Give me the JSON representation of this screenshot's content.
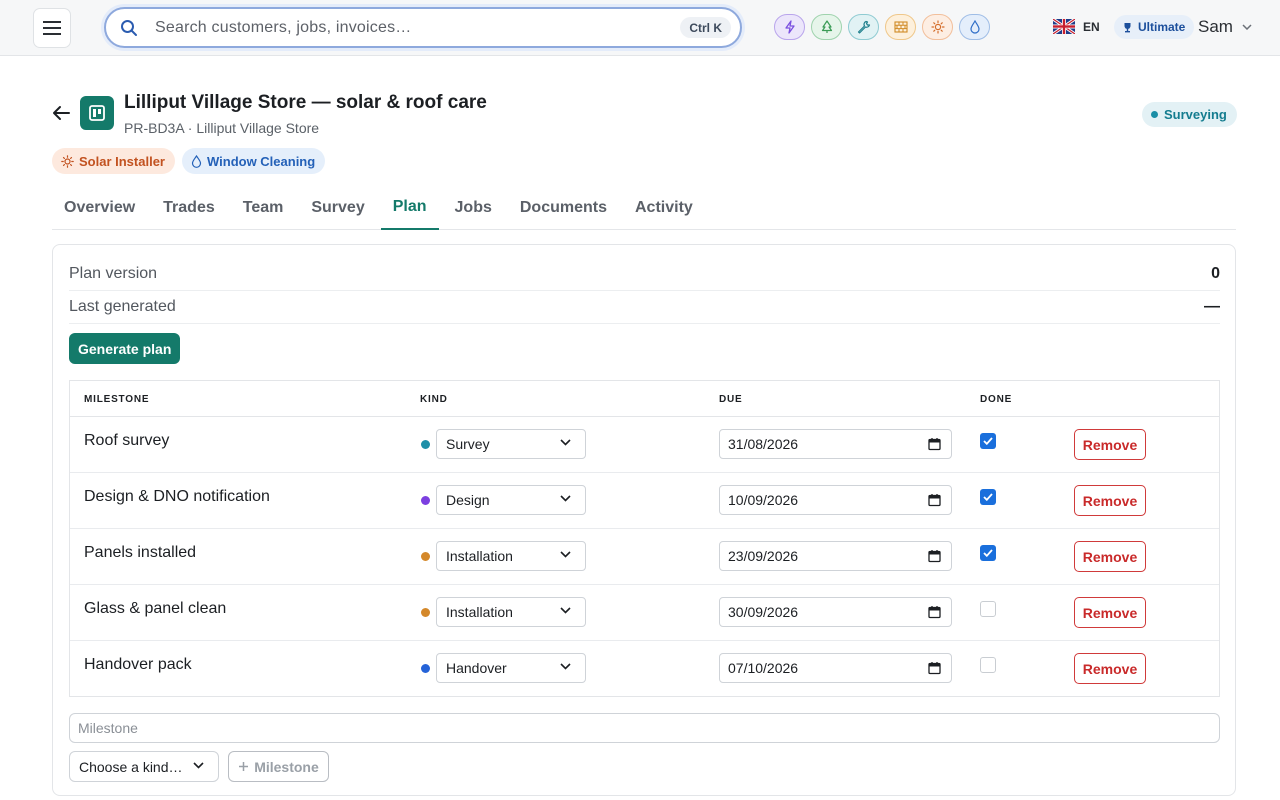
{
  "topbar": {
    "search_placeholder": "Search customers, jobs, invoices…",
    "search_shortcut": "Ctrl K",
    "apps": [
      {
        "icon": "bolt-icon",
        "bg": "#ece6fb",
        "border": "#b9a5ec",
        "color": "#7a4fe0"
      },
      {
        "icon": "tree-icon",
        "bg": "#e6f5ea",
        "border": "#9fd3ad",
        "color": "#3a9b55"
      },
      {
        "icon": "wrench-icon",
        "bg": "#e1f2f4",
        "border": "#8fcbd2",
        "color": "#1f7f8c"
      },
      {
        "icon": "brick-icon",
        "bg": "#fdf0dc",
        "border": "#efc78a",
        "color": "#d08a25"
      },
      {
        "icon": "sun-icon",
        "bg": "#fdeee3",
        "border": "#f2bf9b",
        "color": "#d46d2a"
      },
      {
        "icon": "droplet-icon",
        "bg": "#e4eefb",
        "border": "#9fbde6",
        "color": "#2f6ec7"
      }
    ],
    "language": "EN",
    "plan_badge": "Ultimate",
    "user_name": "Sam"
  },
  "project": {
    "title": "Lilliput Village Store — solar & roof care",
    "subtitle": "PR-BD3A · Lilliput Village Store",
    "status": "Surveying",
    "trades": [
      "Solar Installer",
      "Window Cleaning"
    ]
  },
  "tabs": [
    "Overview",
    "Trades",
    "Team",
    "Survey",
    "Plan",
    "Jobs",
    "Documents",
    "Activity"
  ],
  "active_tab": "Plan",
  "plan": {
    "version_label": "Plan version",
    "version_value": "0",
    "generated_label": "Last generated",
    "generated_value": "—",
    "generate_button": "Generate plan",
    "columns": [
      "MILESTONE",
      "KIND",
      "DUE",
      "DONE"
    ],
    "milestones": [
      {
        "name": "Roof survey",
        "kind": "Survey",
        "kind_color": "#1f8fa8",
        "due": "31/08/2026",
        "done": true,
        "remove": "Remove"
      },
      {
        "name": "Design & DNO notification",
        "kind": "Design",
        "kind_color": "#7c3fe0",
        "due": "10/09/2026",
        "done": true,
        "remove": "Remove"
      },
      {
        "name": "Panels installed",
        "kind": "Installation",
        "kind_color": "#d4882a",
        "due": "23/09/2026",
        "done": true,
        "remove": "Remove"
      },
      {
        "name": "Glass & panel clean",
        "kind": "Installation",
        "kind_color": "#d4882a",
        "due": "30/09/2026",
        "done": false,
        "remove": "Remove"
      },
      {
        "name": "Handover pack",
        "kind": "Handover",
        "kind_color": "#2563d8",
        "due": "07/10/2026",
        "done": false,
        "remove": "Remove"
      }
    ],
    "new_milestone_placeholder": "Milestone",
    "kind_select_placeholder": "Choose a kind…",
    "add_button": "Milestone"
  }
}
